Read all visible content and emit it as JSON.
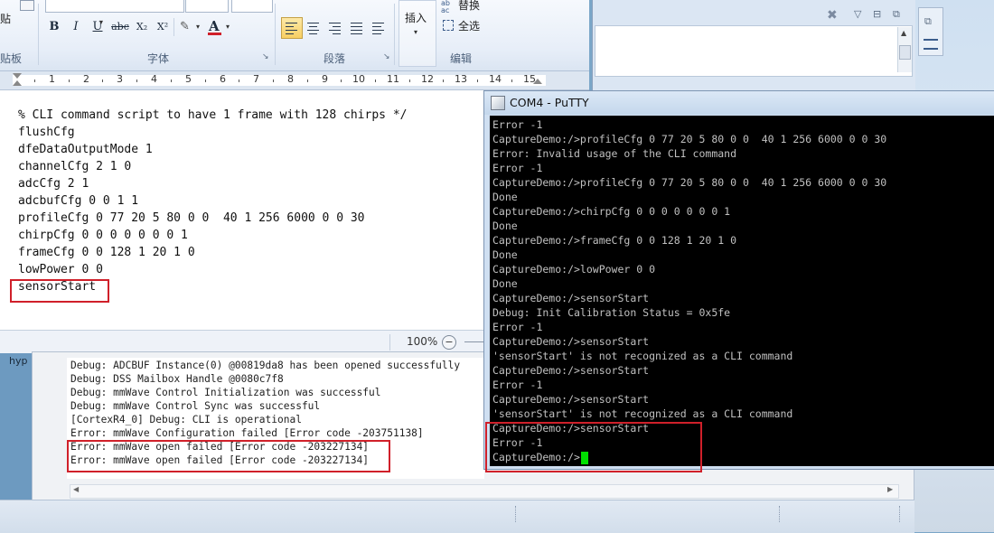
{
  "ribbon": {
    "clipboard_label": "贴板",
    "clipboard_paste": "贴",
    "font_group_label": "字体",
    "paragraph_group_label": "段落",
    "edit_group_label": "编辑",
    "insert_label": "插入",
    "replace_label": "替换",
    "select_all_label": "全选",
    "bold": "B",
    "italic": "I",
    "underline": "U",
    "strikethrough": "abc",
    "subscript": "X₂",
    "superscript": "X²",
    "font_color": "A"
  },
  "ruler": {
    "numbers": [
      "1",
      "2",
      "3",
      "4",
      "5",
      "6",
      "7",
      "8",
      "9",
      "10",
      "11",
      "12",
      "13",
      "14",
      "15"
    ]
  },
  "document": {
    "lines": [
      "% CLI command script to have 1 frame with 128 chirps */",
      "flushCfg",
      "dfeDataOutputMode 1",
      "channelCfg 2 1 0",
      "adcCfg 2 1",
      "adcbufCfg 0 0 1 1",
      "profileCfg 0 77 20 5 80 0 0  40 1 256 6000 0 0 30",
      "chirpCfg 0 0 0 0 0 0 0 1",
      "frameCfg 0 0 128 1 20 1 0",
      "lowPower 0 0",
      "sensorStart"
    ],
    "zoom": "100%"
  },
  "console": {
    "side_text": "hyp",
    "lines": [
      "Debug: ADCBUF Instance(0) @00819da8 has been opened successfully",
      "Debug: DSS Mailbox Handle @0080c7f8",
      "Debug: mmWave Control Initialization was successful",
      "Debug: mmWave Control Sync was successful",
      "[CortexR4_0] Debug: CLI is operational",
      "Error: mmWave Configuration failed [Error code -203751138]",
      "Error: mmWave open failed [Error code -203227134]",
      "Error: mmWave open failed [Error code -203227134]"
    ]
  },
  "putty": {
    "title": "COM4 - PuTTY",
    "lines": [
      "Error -1",
      "CaptureDemo:/>profileCfg 0 77 20 5 80 0 0  40 1 256 6000 0 0 30",
      "Error: Invalid usage of the CLI command",
      "Error -1",
      "CaptureDemo:/>profileCfg 0 77 20 5 80 0 0  40 1 256 6000 0 0 30",
      "Done",
      "CaptureDemo:/>chirpCfg 0 0 0 0 0 0 0 1",
      "Done",
      "CaptureDemo:/>frameCfg 0 0 128 1 20 1 0",
      "Done",
      "CaptureDemo:/>lowPower 0 0",
      "Done",
      "CaptureDemo:/>sensorStart",
      "Debug: Init Calibration Status = 0x5fe",
      "Error -1",
      "CaptureDemo:/>sensorStart",
      "'sensorStart' is not recognized as a CLI command",
      "CaptureDemo:/>sensorStart",
      "Error -1",
      "CaptureDemo:/>sensorStart",
      "'sensorStart' is not recognized as a CLI command",
      "CaptureDemo:/>sensorStart",
      "Error -1",
      "CaptureDemo:/>"
    ]
  },
  "colors": {
    "highlight_box": "#d0202a",
    "terminal_bg": "#000000",
    "terminal_text": "#c0c0c0",
    "cursor": "#00e000"
  }
}
